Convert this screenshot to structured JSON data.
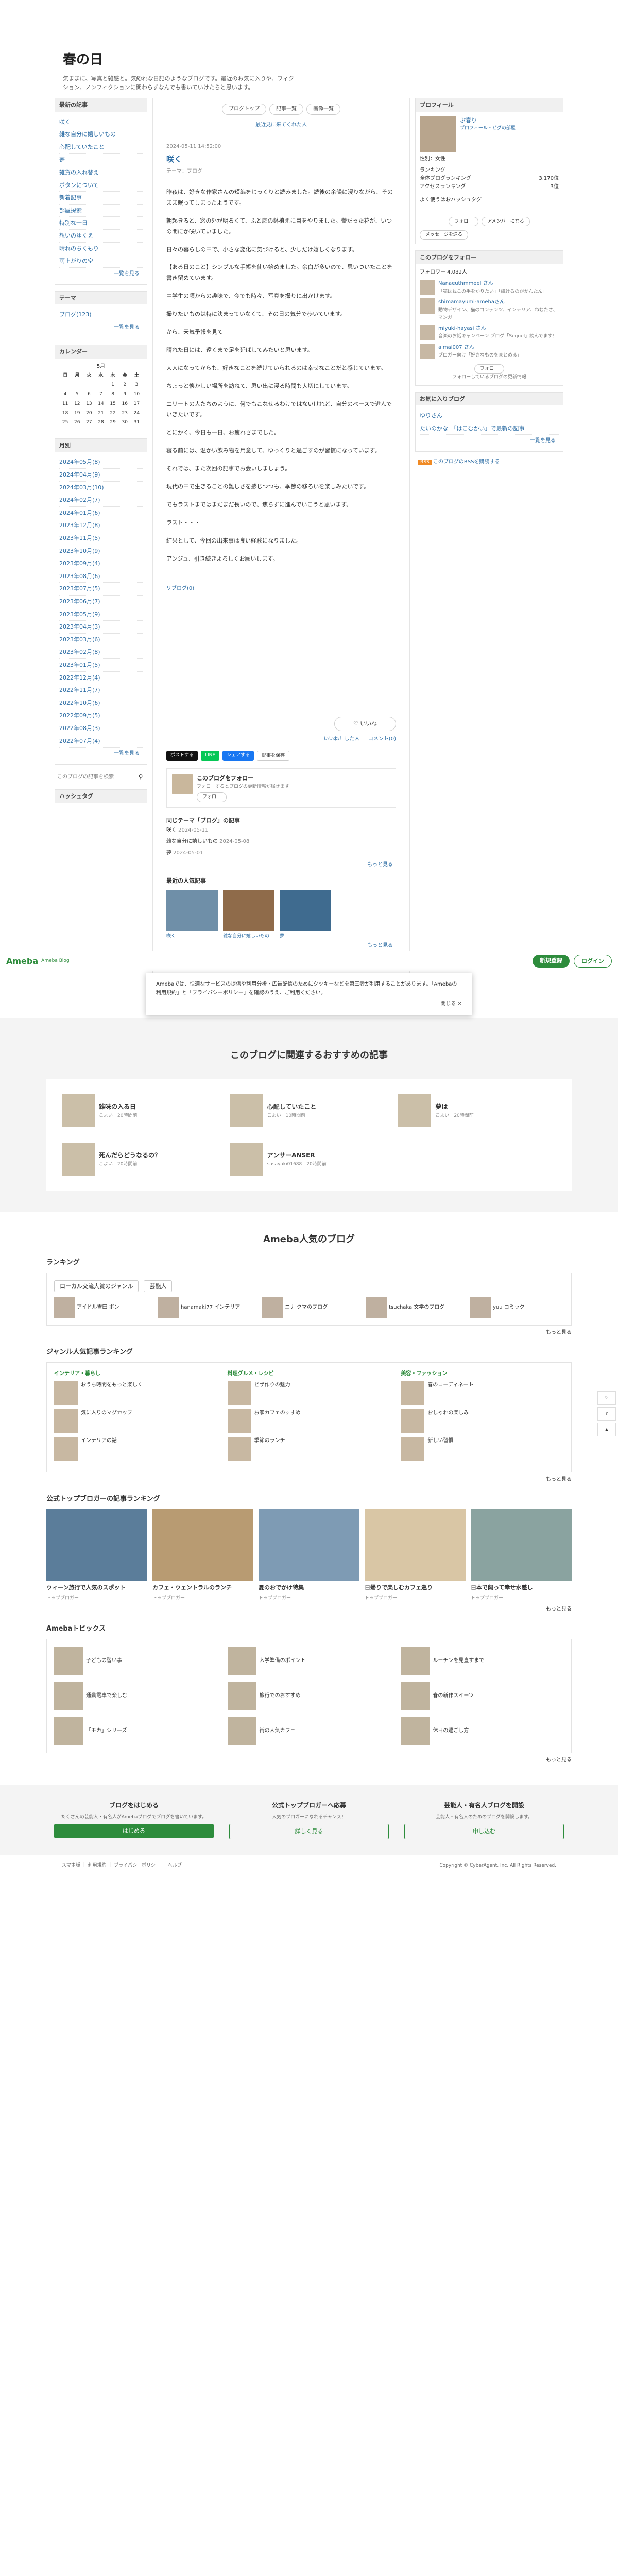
{
  "header": {
    "title": "春の日",
    "description": "気ままに、写真と雑感と。気紛れな日記のようなブログです。最近のお気に入りや、フィクション、ノンフィクションに関わらずなんでも書いていけたらと思います。"
  },
  "sidebar_left": {
    "recent_title": "最新の記事",
    "recent": [
      "咲く",
      "雑な自分に嬉しいもの",
      "心配していたこと",
      "夢",
      "雑貨の入れ替え",
      "ボタンについて",
      "新着記事",
      "部屋探索",
      "特別な一日",
      "想いのゆくえ",
      "晴れのちくもり",
      "雨上がりの空"
    ],
    "recent_more": "一覧を見る",
    "theme_title": "テーマ",
    "themes": [
      "ブログ(123)"
    ],
    "theme_more": "一覧を見る",
    "calendar_title": "カレンダー",
    "calendar_month": "5月",
    "calendar_days": [
      "日",
      "月",
      "火",
      "水",
      "木",
      "金",
      "土"
    ],
    "calendar_rows": [
      [
        "",
        "",
        "",
        "",
        "1",
        "2",
        "3"
      ],
      [
        "4",
        "5",
        "6",
        "7",
        "8",
        "9",
        "10"
      ],
      [
        "11",
        "12",
        "13",
        "14",
        "15",
        "16",
        "17"
      ],
      [
        "18",
        "19",
        "20",
        "21",
        "22",
        "23",
        "24"
      ],
      [
        "25",
        "26",
        "27",
        "28",
        "29",
        "30",
        "31"
      ]
    ],
    "archive_title": "月別",
    "archives": [
      "2024年05月(8)",
      "2024年04月(9)",
      "2024年03月(10)",
      "2024年02月(7)",
      "2024年01月(6)",
      "2023年12月(8)",
      "2023年11月(5)",
      "2023年10月(9)",
      "2023年09月(4)",
      "2023年08月(6)",
      "2023年07月(5)",
      "2023年06月(7)",
      "2023年05月(9)",
      "2023年04月(3)",
      "2023年03月(6)",
      "2023年02月(8)",
      "2023年01月(5)",
      "2022年12月(4)",
      "2022年11月(7)",
      "2022年10月(6)",
      "2022年09月(5)",
      "2022年08月(3)",
      "2022年07月(4)"
    ],
    "archive_more": "一覧を見る",
    "search_placeholder": "このブログの記事を検索",
    "hashtag_title": "ハッシュタグ"
  },
  "toolbar": {
    "blog_top": "ブログトップ",
    "entry_list": "記事一覧",
    "image_list": "画像一覧"
  },
  "top_link": "最近見に来てくれた人",
  "entry": {
    "date": "2024-05-11 14:52:00",
    "title": "咲く",
    "theme": "テーマ：ブログ",
    "paragraphs": [
      "昨夜は、好きな作家さんの短編をじっくりと読みました。読後の余韻に浸りながら、そのまま眠ってしまったようです。",
      "朝起きると、窓の外が明るくて、ふと庭の鉢植えに目をやりました。蕾だった花が、いつの間にか咲いていました。",
      "日々の暮らしの中で、小さな変化に気づけると、少しだけ嬉しくなります。",
      "【ある日のこと】シンプルな手帳を使い始めました。余白が多いので、思いついたことを書き留めています。",
      "中学生の頃からの趣味で、今でも時々、写真を撮りに出かけます。",
      "撮りたいものは特に決まっていなくて、その日の気分で歩いています。",
      "から、天気予報を見て",
      "晴れた日には、遠くまで足を延ばしてみたいと思います。",
      "大人になってからも、好きなことを続けていられるのは幸せなことだと感じています。",
      "ちょっと懐かしい場所を訪ねて、思い出に浸る時間も大切にしています。",
      "エリートの人たちのように、何でもこなせるわけではないけれど、自分のペースで進んでいきたいです。",
      "とにかく、今日も一日、お疲れさまでした。",
      "寝る前には、温かい飲み物を用意して、ゆっくりと過ごすのが習慣になっています。",
      "それでは、また次回の記事でお会いしましょう。",
      "現代の中で生きることの難しさを感じつつも、季節の移ろいを楽しみたいです。",
      "でもラストまではまだまだ長いので、焦らずに進んでいこうと思います。",
      "ラスト・・・",
      "結果として、今回の出来事は良い経験になりました。",
      "アンジュ、引き続きよろしくお願いします。"
    ],
    "reblog_label": "リブログ(0)",
    "like_label": "いいね",
    "like_links": "いいね！した人 ｜ コメント(0)",
    "share": {
      "x": "ポストする",
      "line": "LINE",
      "facebook": "シェアする",
      "hatena": "記事を保存"
    },
    "author_name": "このブログをフォロー",
    "author_text": "フォローするとブログの更新情報が届きます",
    "follow_label": "フォロー",
    "same_theme_title": "同じテーマ「ブログ」の記事",
    "same_theme": [
      {
        "title": "咲く",
        "date": "2024-05-11"
      },
      {
        "title": "雑な自分に嬉しいもの",
        "date": "2024-05-08"
      },
      {
        "title": "夢",
        "date": "2024-05-01"
      }
    ],
    "same_theme_more": "もっと見る",
    "popular_title": "最近の人気記事",
    "popular_more": "もっと見る"
  },
  "sidebar_right": {
    "profile_title": "プロフィール",
    "profile_name": "ぷ春り",
    "profile_links": "プロフィール・ピグの部屋",
    "profile_gender": "性別：女性",
    "ranking_label": "ランキング",
    "ranking_overall": "全体ブログランキング",
    "ranking_overall_value": "3,170位",
    "ranking_genre": "アクセスランキング",
    "ranking_genre_value": "3位",
    "hashtag_label": "よく使うはおハッシュタグ",
    "follow_btn": "フォロー",
    "amember_btn": "アメンバーになる",
    "message_btn": "メッセージを送る",
    "followers_title": "このブログをフォロー",
    "followers_count": "フォロワー 4,082人",
    "followers": [
      {
        "name": "Nanaeuthmmeel さん",
        "text": "「猫はねこの手をかりたい」「続けるのがかんたん」"
      },
      {
        "name": "shimamayumi-amebaさん",
        "text": "動物デザイン、猫のコンテンツ、インテリア、ねむたさ、マンガ"
      },
      {
        "name": "miyuki-hayasi さん",
        "text": "音楽のお話キャンペーン ブログ「Sequel」読んでます！"
      },
      {
        "name": "aimai007 さん",
        "text": "ブロガー向け「好きなものをまとめる」"
      }
    ],
    "followers_follow": "フォロー",
    "followers_note": "フォローしているブログの更新情報",
    "fav_title": "お気に入りブログ",
    "fav_items": [
      "ゆりさん",
      "たいのかな　「はこむかい」で最新の記事"
    ],
    "fav_more": "一覧を見る",
    "rss": "RSS",
    "rss_text": "このブログのRSSを購読する"
  },
  "ameba_bar": {
    "logo": "Ameba",
    "sub": "Ameba Blog",
    "register": "新規登録",
    "login": "ログイン"
  },
  "cookie": {
    "text": "Amebaでは、快適なサービスの提供や利用分析・広告配信のためにクッキーなどを第三者が利用することがあります。「Amebaの利用規約」と「プライバシーポリシー」を確認のうえ、ご利用ください。",
    "close": "閉じる ✕"
  },
  "recommend": {
    "title": "このブログに関連するおすすめの記事",
    "items": [
      {
        "title": "雑味の入る日",
        "meta": "こよい　20時間前"
      },
      {
        "title": "心配していたこと",
        "meta": "こよい　10時間前"
      },
      {
        "title": "夢は",
        "meta": "こよい　20時間前"
      },
      {
        "title": "死んだらどうなるの？",
        "meta": "こよい　20時間前"
      },
      {
        "title": "アンサーANSER",
        "meta": "sasayaki01688　20時間前"
      }
    ]
  },
  "popular": {
    "title": "Ameba人気のブログ",
    "ranking_title": "ランキング",
    "ranking_tabs": [
      "ローカル交流大賞のジャンル",
      "芸能人"
    ],
    "ranking_items": [
      "アイドル吉田 ボン",
      "hanamaki77 インテリア",
      "ニナ クマのブログ",
      "tsuchaka 文学のブログ",
      "yuu コミック"
    ],
    "see_more": "もっと見る",
    "genre_title": "ジャンル人気記事ランキング",
    "genres": [
      {
        "name": "インテリア・暮らし",
        "items": [
          "おうち時間をもっと楽しく",
          "気に入りのマグカップ",
          "インテリアの話"
        ]
      },
      {
        "name": "料理グルメ・レシピ",
        "items": [
          "ピザ作りの魅力",
          "お家カフェのすすめ",
          "季節のランチ"
        ]
      },
      {
        "name": "美容・ファッション",
        "items": [
          "春のコーディネート",
          "おしゃれの楽しみ",
          "新しい習慣"
        ]
      }
    ],
    "official_title": "公式トップブロガーの記事ランキング",
    "official": [
      {
        "title": "ウィーン旅行で人気のスポット",
        "meta": "トップブロガー"
      },
      {
        "title": "カフェ・ウェントラルのランチ",
        "meta": "トップブロガー"
      },
      {
        "title": "夏のおでかけ特集",
        "meta": "トップブロガー"
      },
      {
        "title": "日帰りで楽しむカフェ巡り",
        "meta": "トップブロガー"
      },
      {
        "title": "日本で飼って幸せ水差し",
        "meta": "トップブロガー"
      }
    ],
    "topics_title": "Amebaトピックス",
    "topics": [
      "子どもの習い事",
      "入学準備のポイント",
      "ルーチンを見直すまで",
      "通勤電車で楽しむ",
      "旅行でのおすすめ",
      "春の新作スイーツ",
      "「モカ」シリーズ",
      "街の人気カフェ",
      "休日の過ごし方"
    ]
  },
  "cta": [
    {
      "title": "ブログをはじめる",
      "text": "たくさんの芸能人・有名人がAmebaブログでブログを書いています。",
      "button": "はじめる"
    },
    {
      "title": "公式トップブロガーへ応募",
      "text": "人気のブロガーになれるチャンス！",
      "button": "詳しく見る"
    },
    {
      "title": "芸能人・有名人ブログを開設",
      "text": "芸能人・有名人のためのブログを開設します。",
      "button": "申し込む"
    }
  ],
  "footer": {
    "left": "スマホ版 ｜ 利用規約 ｜ プライバシーポリシー ｜ ヘルプ",
    "right": "Copyright © CyberAgent, Inc. All Rights Reserved."
  }
}
